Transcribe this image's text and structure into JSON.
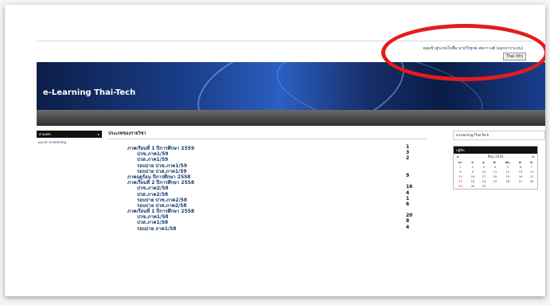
{
  "header": {
    "login_label": "คุณเข้าสู่ระบบในชื่อ",
    "login_user": "นายวีรยุทธ สมกาวงศ์",
    "logout": "(ออกจากระบบ)",
    "lang_select": "Thai (th)"
  },
  "banner": {
    "title": "e-Learning Thai-Tech"
  },
  "left_block": {
    "header": "ส่วนหลัก",
    "item": "แนะนำ e-Learning"
  },
  "main": {
    "title": "ประเภทของรายวิชา",
    "rows": [
      {
        "label": "ภาคเรียนที่ 1 ปีการศึกษา 2559",
        "count": "1",
        "level": 1
      },
      {
        "label": "ปวช.ภาค1/59",
        "count": "3",
        "level": 2
      },
      {
        "label": "ปวส.ภาค1/59",
        "count": "2",
        "level": 2
      },
      {
        "label": "รอบบ่าย ปวช.ภาค1/59",
        "count": "",
        "level": 2
      },
      {
        "label": "รอบบ่าย ปวส.ภาค1/59",
        "count": "",
        "level": 2
      },
      {
        "label": "ภาคฤดูร้อน ปีการศึกษา 2558",
        "count": "9",
        "level": 1
      },
      {
        "label": "ภาคเรียนที่ 2 ปีการศึกษา 2558",
        "count": "",
        "level": 1
      },
      {
        "label": "ปวช.ภาค2/58",
        "count": "16",
        "level": 2
      },
      {
        "label": "ปวส.ภาค2/58",
        "count": "4",
        "level": 2
      },
      {
        "label": "รอบบ่าย ปวช.ภาค2/58",
        "count": "1",
        "level": 2
      },
      {
        "label": "รอบบ่าย ปวส.ภาค2/58",
        "count": "6",
        "level": 2
      },
      {
        "label": "ภาคเรียนที่ 1 ปีการศึกษา 2558",
        "count": "",
        "level": 1
      },
      {
        "label": "ปวช.ภาค1/58",
        "count": "20",
        "level": 2
      },
      {
        "label": "ปวส.ภาค1/58",
        "count": "8",
        "level": 2
      },
      {
        "label": "รอบบ่าย ภาค1/58",
        "count": "4",
        "level": 2
      }
    ]
  },
  "right_block": {
    "title": "e-Learning Thai-Tech",
    "calendar": {
      "header": "ปฏิทิน",
      "month": "May 2016",
      "prev": "◄",
      "next": "►",
      "days": [
        "อา.",
        "จ.",
        "อ.",
        "พ.",
        "พฤ.",
        "ศ.",
        "ส."
      ],
      "weeks": [
        [
          "1",
          "2",
          "3",
          "4",
          "5",
          "6",
          "7"
        ],
        [
          "8",
          "9",
          "10",
          "11",
          "12",
          "13",
          "14"
        ],
        [
          "15",
          "16",
          "17",
          "18",
          "19",
          "20",
          "21"
        ],
        [
          "22",
          "23",
          "24",
          "25",
          "26",
          "27",
          "28"
        ],
        [
          "29",
          "30",
          "31",
          "",
          "",
          "",
          ""
        ]
      ]
    }
  },
  "colors": {
    "link": "#1a3c6e",
    "highlight": "#e31c1c",
    "banner": "#1a3e8a"
  }
}
